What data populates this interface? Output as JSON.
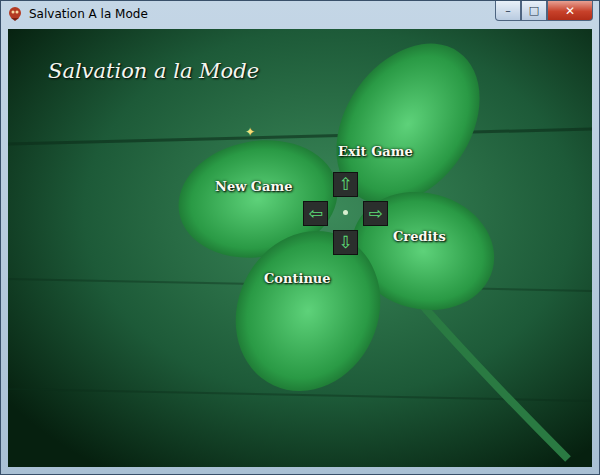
{
  "window": {
    "title": "Salvation A la Mode",
    "controls": [
      {
        "kind": "minimize",
        "glyph": "–"
      },
      {
        "kind": "maximize",
        "glyph": "□"
      },
      {
        "kind": "close",
        "glyph": "✕"
      }
    ]
  },
  "game": {
    "title": "Salvation a la Mode",
    "menu": [
      {
        "label": "Exit Game",
        "kind": "up"
      },
      {
        "label": "New Game",
        "kind": "left"
      },
      {
        "label": "Credits",
        "kind": "right"
      },
      {
        "label": "Continue",
        "kind": "down"
      }
    ],
    "arrows": [
      {
        "glyph": "⇧",
        "kind": "up"
      },
      {
        "glyph": "⇦",
        "kind": "left"
      },
      {
        "glyph": "⇨",
        "kind": "right"
      },
      {
        "glyph": "⇩",
        "kind": "down"
      }
    ],
    "cursor": "✦"
  }
}
